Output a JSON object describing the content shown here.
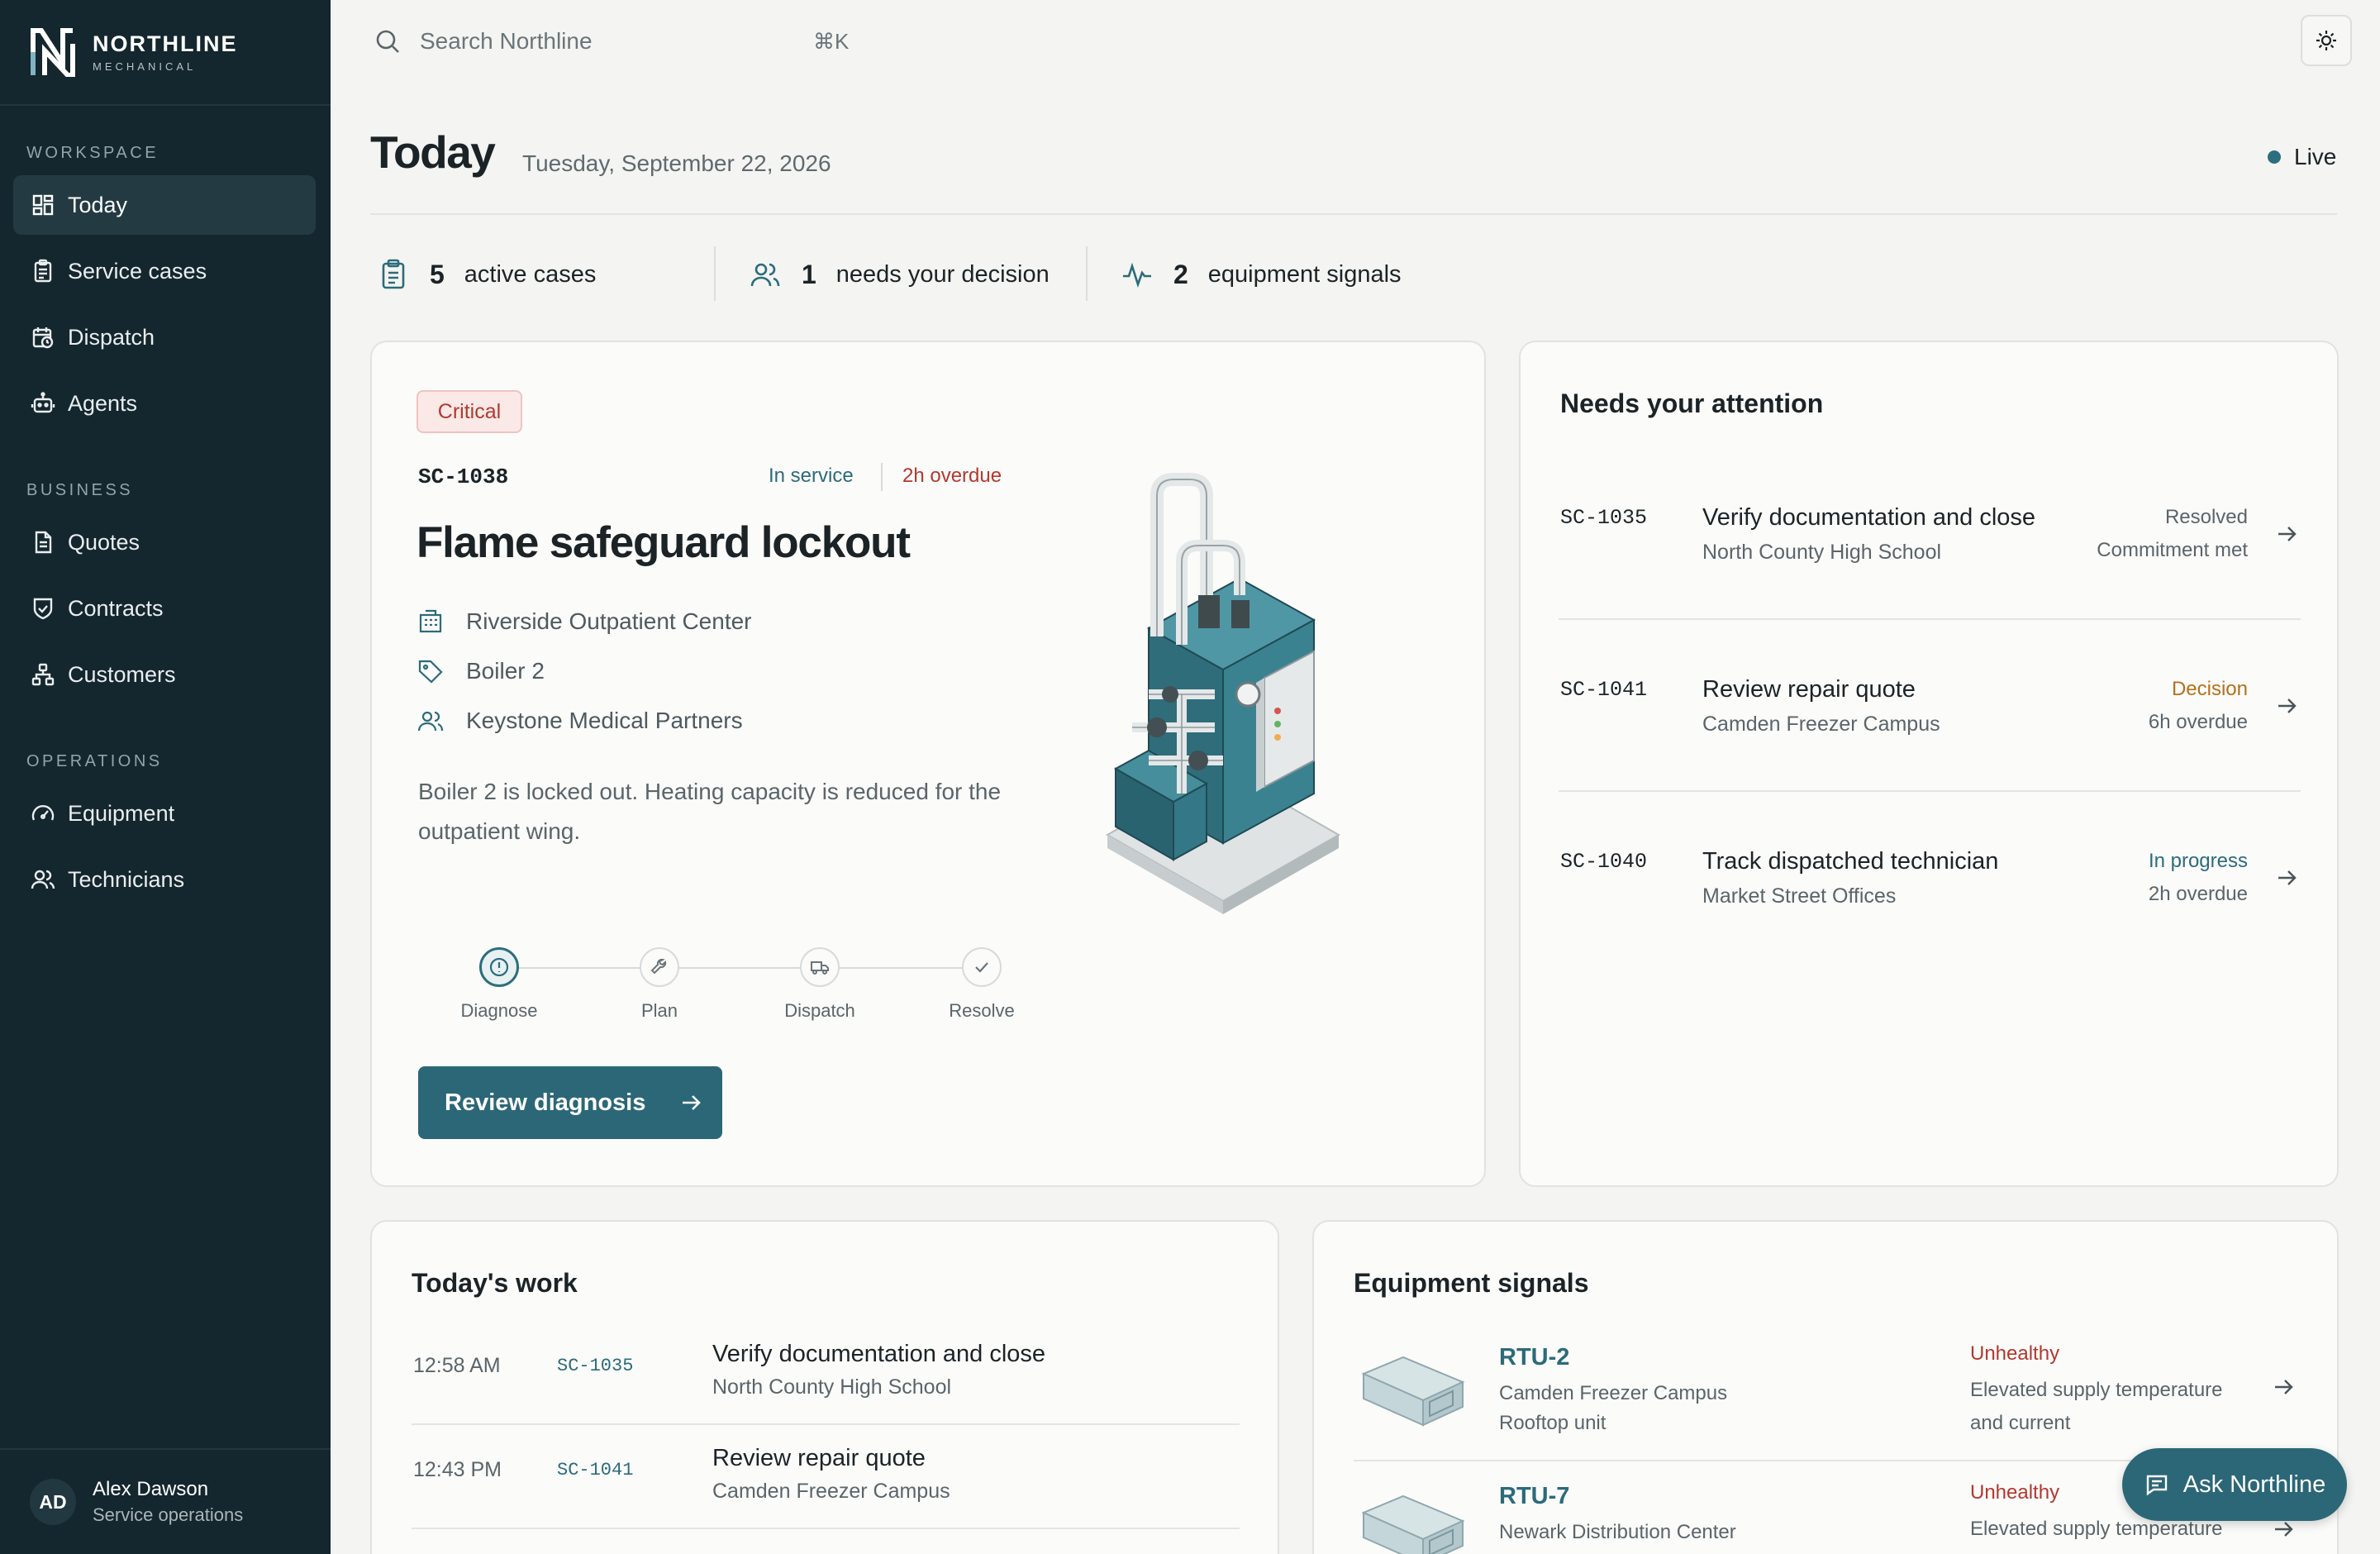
{
  "brand": {
    "name": "NORTHLINE",
    "sub": "MECHANICAL"
  },
  "sidebar": {
    "sections": [
      "WORKSPACE",
      "BUSINESS",
      "OPERATIONS"
    ],
    "items": [
      {
        "label": "Today",
        "icon": "dashboard-icon",
        "active": true
      },
      {
        "label": "Service cases",
        "icon": "clipboard-icon"
      },
      {
        "label": "Dispatch",
        "icon": "calendar-clock-icon"
      },
      {
        "label": "Agents",
        "icon": "robot-icon"
      },
      {
        "label": "Quotes",
        "icon": "document-icon"
      },
      {
        "label": "Contracts",
        "icon": "handshake-icon"
      },
      {
        "label": "Customers",
        "icon": "org-chart-icon"
      },
      {
        "label": "Equipment",
        "icon": "gauge-icon"
      },
      {
        "label": "Technicians",
        "icon": "users-icon"
      }
    ],
    "user": {
      "initials": "AD",
      "name": "Alex Dawson",
      "role": "Service operations"
    }
  },
  "topbar": {
    "search_placeholder": "Search Northline",
    "shortcut": "⌘K"
  },
  "header": {
    "title": "Today",
    "date": "Tuesday, September 22, 2026",
    "live": "Live"
  },
  "stats": [
    {
      "value": "5",
      "label": "active cases"
    },
    {
      "value": "1",
      "label": "needs your decision"
    },
    {
      "value": "2",
      "label": "equipment signals"
    }
  ],
  "featured": {
    "severity": "Critical",
    "id": "SC-1038",
    "status": "In service",
    "overdue": "2h overdue",
    "title": "Flame safeguard lockout",
    "site": "Riverside Outpatient Center",
    "asset": "Boiler 2",
    "customer": "Keystone Medical Partners",
    "description": "Boiler 2 is locked out. Heating capacity is reduced for the outpatient wing.",
    "steps": [
      "Diagnose",
      "Plan",
      "Dispatch",
      "Resolve"
    ],
    "current_step": "Diagnose",
    "action": "Review diagnosis"
  },
  "attention": {
    "title": "Needs your attention",
    "items": [
      {
        "id": "SC-1035",
        "title": "Verify documentation and close",
        "site": "North County High School",
        "status": "Resolved",
        "status_color": "#5a6569",
        "note": "Commitment met"
      },
      {
        "id": "SC-1041",
        "title": "Review repair quote",
        "site": "Camden Freezer Campus",
        "status": "Decision",
        "status_color": "#b5701a",
        "note": "6h overdue"
      },
      {
        "id": "SC-1040",
        "title": "Track dispatched technician",
        "site": "Market Street Offices",
        "status": "In progress",
        "status_color": "#2b6b7b",
        "note": "2h overdue"
      }
    ]
  },
  "work": {
    "title": "Today's work",
    "items": [
      {
        "time": "12:58 AM",
        "id": "SC-1035",
        "title": "Verify documentation and close",
        "site": "North County High School"
      },
      {
        "time": "12:43 PM",
        "id": "SC-1041",
        "title": "Review repair quote",
        "site": "Camden Freezer Campus"
      }
    ]
  },
  "signals": {
    "title": "Equipment signals",
    "items": [
      {
        "name": "RTU-2",
        "site": "Camden Freezer Campus",
        "type": "Rooftop unit",
        "status": "Unhealthy",
        "desc": "Elevated supply temperature and current"
      },
      {
        "name": "RTU-7",
        "site": "Newark Distribution Center",
        "type": "",
        "status": "Unhealthy",
        "desc": "Elevated supply temperature"
      }
    ]
  },
  "ask_button": "Ask Northline",
  "colors": {
    "sidebar": "#14262e",
    "accent": "#2b6777",
    "critical": "#b3382f",
    "warning": "#b5701a"
  }
}
